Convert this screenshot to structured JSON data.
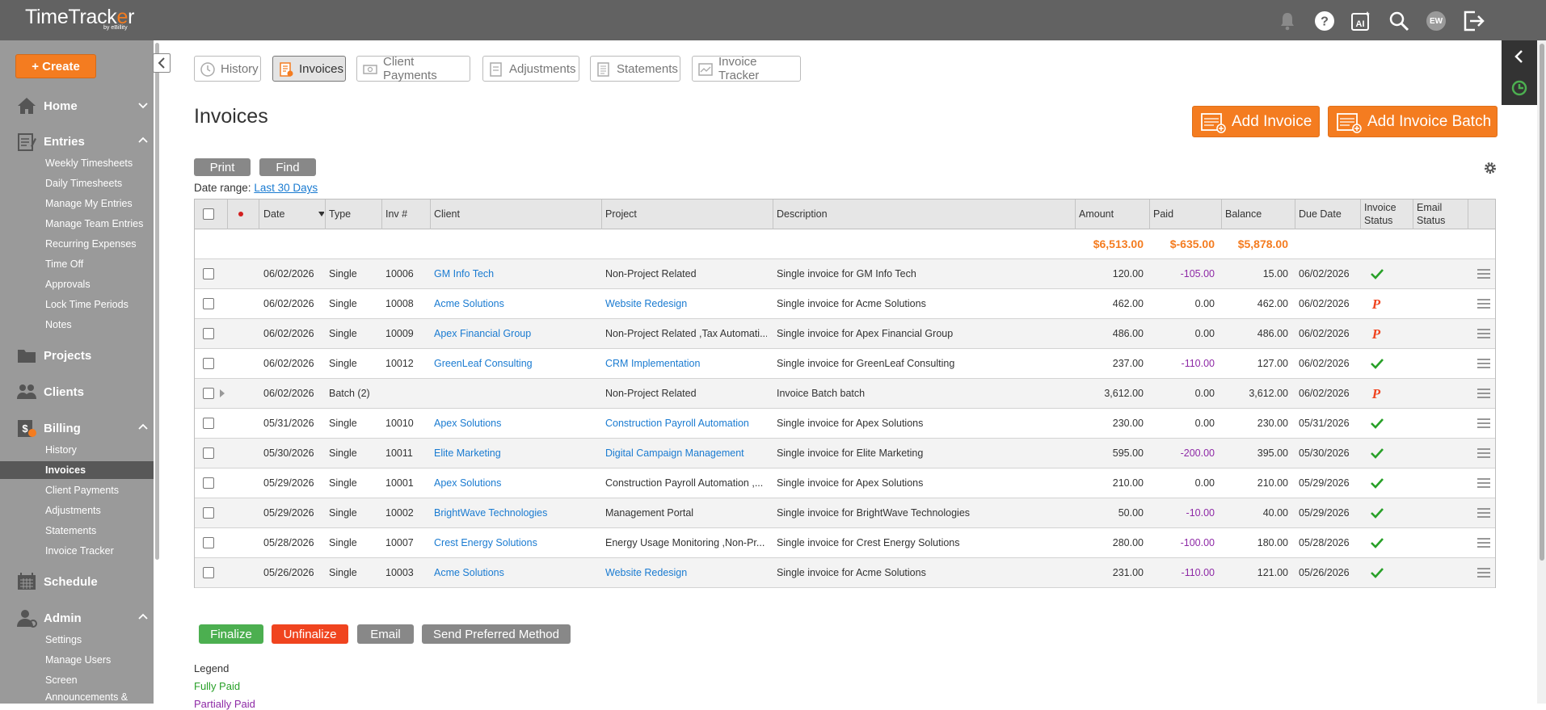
{
  "app": {
    "name_part1": "TimeTrack",
    "name_o": "e",
    "name_part2": "r",
    "subtitle": "by eBillity",
    "user_initials": "EW"
  },
  "sidebar": {
    "create_label": "+ Create",
    "sections": [
      {
        "label": "Home",
        "icon": "house-icon"
      },
      {
        "label": "Entries",
        "icon": "clipboard-icon"
      },
      {
        "label": "Projects",
        "icon": "folder-icon"
      },
      {
        "label": "Clients",
        "icon": "people-icon"
      },
      {
        "label": "Billing",
        "icon": "billing-icon"
      },
      {
        "label": "Schedule",
        "icon": "calendar-icon"
      },
      {
        "label": "Admin",
        "icon": "admin-icon"
      }
    ],
    "entries_items": [
      "Weekly Timesheets",
      "Daily Timesheets",
      "Manage My Entries",
      "Manage Team Entries",
      "Recurring Expenses",
      "Time Off",
      "Approvals",
      "Lock Time Periods",
      "Notes"
    ],
    "billing_items": [
      "History",
      "Invoices",
      "Client Payments",
      "Adjustments",
      "Statements",
      "Invoice Tracker"
    ],
    "admin_items": [
      "Settings",
      "Manage Users",
      "Screen",
      "Announcements &"
    ]
  },
  "tabs": [
    {
      "label": "History",
      "icon": "history-icon"
    },
    {
      "label": "Invoices",
      "icon": "invoice-icon"
    },
    {
      "label": "Client Payments",
      "icon": "payment-icon"
    },
    {
      "label": "Adjustments",
      "icon": "adjustment-icon"
    },
    {
      "label": "Statements",
      "icon": "statement-icon"
    },
    {
      "label": "Invoice Tracker",
      "icon": "tracker-icon"
    }
  ],
  "page": {
    "title": "Invoices",
    "add_invoice": "Add Invoice",
    "add_invoice_batch": "Add Invoice Batch",
    "print": "Print",
    "find": "Find",
    "date_range_label": "Date range:",
    "date_range_value": "Last 30 Days"
  },
  "table": {
    "headers": {
      "date": "Date",
      "type": "Type",
      "inv": "Inv #",
      "client": "Client",
      "project": "Project",
      "description": "Description",
      "amount": "Amount",
      "paid": "Paid",
      "balance": "Balance",
      "due": "Due Date",
      "invoice_status_1": "Invoice",
      "invoice_status_2": "Status",
      "email_status_1": "Email",
      "email_status_2": "Status"
    },
    "totals": {
      "amount": "$6,513.00",
      "paid": "$-635.00",
      "balance": "$5,878.00"
    },
    "rows": [
      {
        "date": "06/02/2026",
        "type": "Single",
        "inv": "10006",
        "client": "GM Info Tech",
        "project": "Non-Project Related",
        "project_link": false,
        "description": "Single invoice for GM Info Tech",
        "amount": "120.00",
        "paid": "-105.00",
        "paid_neg": true,
        "balance": "15.00",
        "due": "06/02/2026",
        "status": "paid"
      },
      {
        "date": "06/02/2026",
        "type": "Single",
        "inv": "10008",
        "client": "Acme Solutions",
        "project": "Website Redesign",
        "project_link": true,
        "description": "Single invoice for Acme Solutions",
        "amount": "462.00",
        "paid": "0.00",
        "paid_neg": false,
        "balance": "462.00",
        "due": "06/02/2026",
        "status": "pending"
      },
      {
        "date": "06/02/2026",
        "type": "Single",
        "inv": "10009",
        "client": "Apex Financial Group",
        "project": "Non-Project Related ,Tax Automati...",
        "project_link": false,
        "description": "Single invoice for Apex Financial Group",
        "amount": "486.00",
        "paid": "0.00",
        "paid_neg": false,
        "balance": "486.00",
        "due": "06/02/2026",
        "status": "pending"
      },
      {
        "date": "06/02/2026",
        "type": "Single",
        "inv": "10012",
        "client": "GreenLeaf Consulting",
        "project": "CRM Implementation",
        "project_link": true,
        "description": "Single invoice for GreenLeaf Consulting",
        "amount": "237.00",
        "paid": "-110.00",
        "paid_neg": true,
        "balance": "127.00",
        "due": "06/02/2026",
        "status": "paid"
      },
      {
        "date": "06/02/2026",
        "type": "Batch (2)",
        "inv": "",
        "client": "",
        "project": "Non-Project Related",
        "project_link": false,
        "description": "Invoice Batch batch",
        "amount": "3,612.00",
        "paid": "0.00",
        "paid_neg": false,
        "balance": "3,612.00",
        "due": "06/02/2026",
        "status": "pending",
        "batch": true
      },
      {
        "date": "05/31/2026",
        "type": "Single",
        "inv": "10010",
        "client": "Apex Solutions",
        "project": "Construction Payroll Automation",
        "project_link": true,
        "description": "Single invoice for Apex Solutions",
        "amount": "230.00",
        "paid": "0.00",
        "paid_neg": false,
        "balance": "230.00",
        "due": "05/31/2026",
        "status": "paid"
      },
      {
        "date": "05/30/2026",
        "type": "Single",
        "inv": "10011",
        "client": "Elite Marketing",
        "project": "Digital Campaign Management",
        "project_link": true,
        "description": "Single invoice for Elite Marketing",
        "amount": "595.00",
        "paid": "-200.00",
        "paid_neg": true,
        "balance": "395.00",
        "due": "05/30/2026",
        "status": "paid"
      },
      {
        "date": "05/29/2026",
        "type": "Single",
        "inv": "10001",
        "client": "Apex Solutions",
        "project": "Construction Payroll Automation ,...",
        "project_link": false,
        "description": "Single invoice for Apex Solutions",
        "amount": "210.00",
        "paid": "0.00",
        "paid_neg": false,
        "balance": "210.00",
        "due": "05/29/2026",
        "status": "paid"
      },
      {
        "date": "05/29/2026",
        "type": "Single",
        "inv": "10002",
        "client": "BrightWave Technologies",
        "project": "Management Portal",
        "project_link": false,
        "description": "Single invoice for BrightWave Technologies",
        "amount": "50.00",
        "paid": "-10.00",
        "paid_neg": true,
        "balance": "40.00",
        "due": "05/29/2026",
        "status": "paid"
      },
      {
        "date": "05/28/2026",
        "type": "Single",
        "inv": "10007",
        "client": "Crest Energy Solutions",
        "project": "Energy Usage Monitoring ,Non-Pr...",
        "project_link": false,
        "description": "Single invoice for Crest Energy Solutions",
        "amount": "280.00",
        "paid": "-100.00",
        "paid_neg": true,
        "balance": "180.00",
        "due": "05/28/2026",
        "status": "paid"
      },
      {
        "date": "05/26/2026",
        "type": "Single",
        "inv": "10003",
        "client": "Acme Solutions",
        "project": "Website Redesign",
        "project_link": true,
        "description": "Single invoice for Acme Solutions",
        "amount": "231.00",
        "paid": "-110.00",
        "paid_neg": true,
        "balance": "121.00",
        "due": "05/26/2026",
        "status": "paid"
      }
    ]
  },
  "actions": {
    "finalize": "Finalize",
    "unfinalize": "Unfinalize",
    "email": "Email",
    "send_preferred": "Send Preferred Method"
  },
  "legend": {
    "title": "Legend",
    "fully_paid": "Fully Paid",
    "partially_paid": "Partially Paid"
  },
  "colors": {
    "accent": "#f47c20",
    "topbar": "#626262",
    "sidebar": "#9a9a9a",
    "link": "#1a7bd1",
    "paid_green": "#28a028",
    "partial_purple": "#8e2aa6",
    "finalize_green": "#4caf50",
    "unfinalize_red": "#f0441f"
  }
}
